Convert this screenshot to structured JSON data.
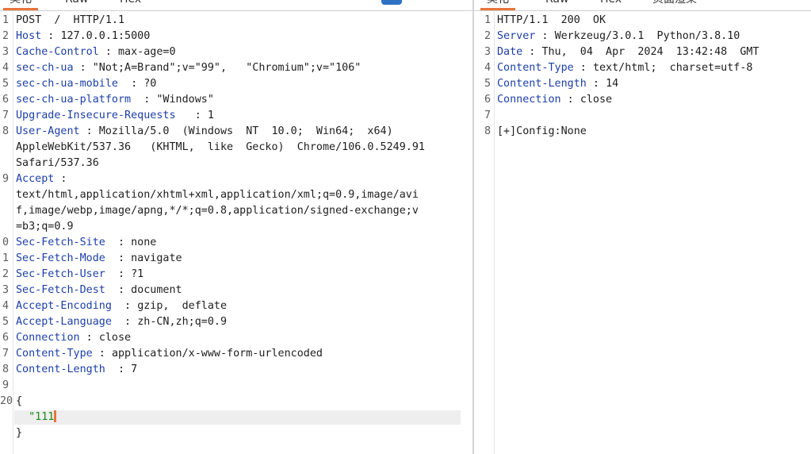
{
  "left": {
    "tabs": [
      {
        "label": "美化"
      },
      {
        "label": "Raw"
      },
      {
        "label": "Hex"
      }
    ],
    "toolbar": [
      {
        "icon": "format-toggle-icon"
      },
      {
        "icon": "newline-toggle-icon"
      },
      {
        "icon": "menu-icon"
      }
    ],
    "lines": [
      {
        "n": "1",
        "key": "",
        "sep": "",
        "text": "POST  /  HTTP/1.1"
      },
      {
        "n": "2",
        "key": "Host",
        "sep": " : ",
        "text": "127.0.0.1:5000"
      },
      {
        "n": "3",
        "key": "Cache-Control",
        "sep": " : ",
        "text": "max-age=0"
      },
      {
        "n": "4",
        "key": "sec-ch-ua",
        "sep": " : ",
        "text": "\"Not;A=Brand\";v=\"99\",   \"Chromium\";v=\"106\""
      },
      {
        "n": "5",
        "key": "sec-ch-ua-mobile",
        "sep": "  : ",
        "text": "?0"
      },
      {
        "n": "6",
        "key": "sec-ch-ua-platform",
        "sep": "  : ",
        "text": "\"Windows\""
      },
      {
        "n": "7",
        "key": "Upgrade-Insecure-Requests",
        "sep": "   : ",
        "text": "1"
      },
      {
        "n": "8",
        "key": "User-Agent",
        "sep": " : ",
        "text": "Mozilla/5.0  (Windows  NT  10.0;  Win64;  x64)"
      },
      {
        "n": "",
        "key": "",
        "sep": "",
        "text": "AppleWebKit/537.36   (KHTML,  like  Gecko)  Chrome/106.0.5249.91"
      },
      {
        "n": "",
        "key": "",
        "sep": "",
        "text": "Safari/537.36"
      },
      {
        "n": "9",
        "key": "Accept",
        "sep": " :",
        "text": ""
      },
      {
        "n": "",
        "key": "",
        "sep": "",
        "text": "text/html,application/xhtml+xml,application/xml;q=0.9,image/avi"
      },
      {
        "n": "",
        "key": "",
        "sep": "",
        "text": "f,image/webp,image/apng,*/*;q=0.8,application/signed-exchange;v"
      },
      {
        "n": "",
        "key": "",
        "sep": "",
        "text": "=b3;q=0.9"
      },
      {
        "n": "0",
        "key": "Sec-Fetch-Site",
        "sep": "  : ",
        "text": "none"
      },
      {
        "n": "1",
        "key": "Sec-Fetch-Mode",
        "sep": "  : ",
        "text": "navigate"
      },
      {
        "n": "2",
        "key": "Sec-Fetch-User",
        "sep": "  : ",
        "text": "?1"
      },
      {
        "n": "3",
        "key": "Sec-Fetch-Dest",
        "sep": "  : ",
        "text": "document"
      },
      {
        "n": "4",
        "key": "Accept-Encoding",
        "sep": "  : ",
        "text": "gzip,  deflate"
      },
      {
        "n": "5",
        "key": "Accept-Language",
        "sep": "  : ",
        "text": "zh-CN,zh;q=0.9"
      },
      {
        "n": "6",
        "key": "Connection",
        "sep": " : ",
        "text": "close"
      },
      {
        "n": "7",
        "key": "Content-Type",
        "sep": " : ",
        "text": "application/x-www-form-urlencoded"
      },
      {
        "n": "8",
        "key": "Content-Length",
        "sep": "  : ",
        "text": "7"
      },
      {
        "n": "9",
        "key": "",
        "sep": "",
        "text": ""
      },
      {
        "n": "20",
        "key": "",
        "sep": "",
        "text": "{"
      },
      {
        "n": "",
        "key": "",
        "sep": "",
        "text": "",
        "str": "  \"111",
        "caret": true
      },
      {
        "n": "",
        "key": "",
        "sep": "",
        "text": "}"
      }
    ]
  },
  "right": {
    "tabs": [
      {
        "label": "美化"
      },
      {
        "label": "Raw"
      },
      {
        "label": "Hex"
      },
      {
        "label": "页面渲染"
      }
    ],
    "lines": [
      {
        "n": "1",
        "key": "",
        "sep": "",
        "text": "HTTP/1.1  200  OK"
      },
      {
        "n": "2",
        "key": "Server",
        "sep": " : ",
        "text": "Werkzeug/3.0.1  Python/3.8.10"
      },
      {
        "n": "3",
        "key": "Date",
        "sep": " : ",
        "text": "Thu,  04  Apr  2024  13:42:48  GMT"
      },
      {
        "n": "4",
        "key": "Content-Type",
        "sep": " : ",
        "text": "text/html;  charset=utf-8"
      },
      {
        "n": "5",
        "key": "Content-Length",
        "sep": " : ",
        "text": "14"
      },
      {
        "n": "6",
        "key": "Connection",
        "sep": " : ",
        "text": "close"
      },
      {
        "n": "7",
        "key": "",
        "sep": "",
        "text": ""
      },
      {
        "n": "8",
        "key": "",
        "sep": "",
        "text": "[+]Config:None"
      }
    ]
  },
  "colors": {
    "header_key": "#1c3fa8",
    "string": "#1c8a1c",
    "accent": "#e8743b",
    "badge": "#2f72c4"
  }
}
